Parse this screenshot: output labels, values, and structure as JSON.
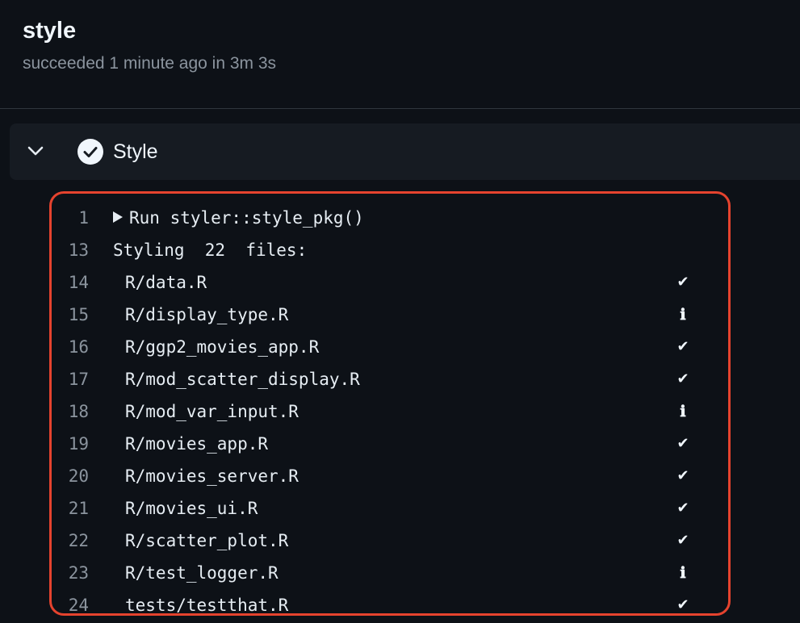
{
  "job": {
    "title": "style",
    "status_text": "succeeded 1 minute ago in 3m 3s"
  },
  "step": {
    "name": "Style",
    "expanded": true,
    "status_icon": "check-circle-icon"
  },
  "colors": {
    "background": "#0d1117",
    "step_background": "#161b22",
    "highlight_border": "#e5432e",
    "muted_text": "#8b949e"
  },
  "log": {
    "lines": [
      {
        "num": "1",
        "text": "Run styler::style_pkg()",
        "collapsible": true,
        "status": ""
      },
      {
        "num": "13",
        "text": "Styling  22  files:",
        "status": ""
      },
      {
        "num": "14",
        "text": "R/data.R",
        "status": "✔"
      },
      {
        "num": "15",
        "text": "R/display_type.R",
        "status": "ℹ"
      },
      {
        "num": "16",
        "text": "R/ggp2_movies_app.R",
        "status": "✔"
      },
      {
        "num": "17",
        "text": "R/mod_scatter_display.R",
        "status": "✔"
      },
      {
        "num": "18",
        "text": "R/mod_var_input.R",
        "status": "ℹ"
      },
      {
        "num": "19",
        "text": "R/movies_app.R",
        "status": "✔"
      },
      {
        "num": "20",
        "text": "R/movies_server.R",
        "status": "✔"
      },
      {
        "num": "21",
        "text": "R/movies_ui.R",
        "status": "✔"
      },
      {
        "num": "22",
        "text": "R/scatter_plot.R",
        "status": "✔"
      },
      {
        "num": "23",
        "text": "R/test_logger.R",
        "status": "ℹ"
      },
      {
        "num": "24",
        "text": "tests/testthat.R",
        "status": "✔"
      }
    ]
  }
}
